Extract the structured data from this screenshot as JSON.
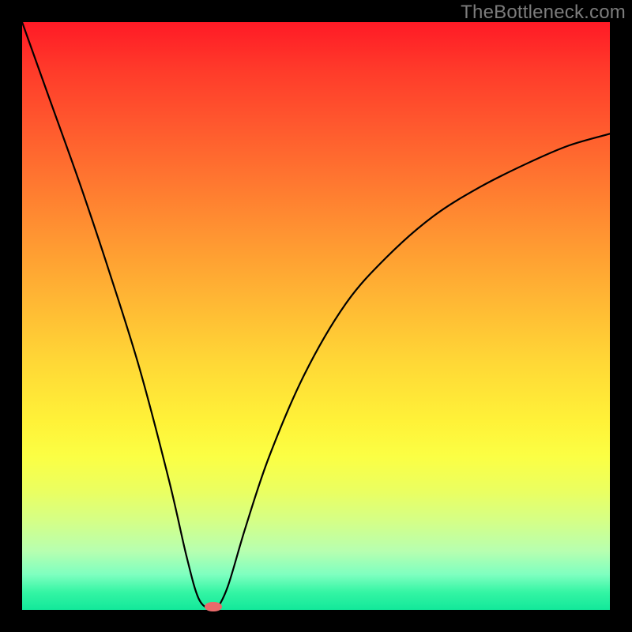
{
  "watermark": "TheBottleneck.com",
  "colors": {
    "frame_bg": "#000000",
    "curve": "#000000",
    "marker": "#e96a6a",
    "watermark": "#7c7c7c"
  },
  "chart_data": {
    "type": "line",
    "title": "",
    "xlabel": "",
    "ylabel": "",
    "xlim": [
      0,
      100
    ],
    "ylim": [
      0,
      100
    ],
    "grid": false,
    "x": [
      0,
      5,
      10,
      15,
      20,
      25,
      28,
      30,
      32,
      33,
      35,
      38,
      42,
      48,
      55,
      62,
      70,
      78,
      86,
      93,
      100
    ],
    "values": [
      100,
      86,
      72,
      57,
      41,
      22,
      9,
      2,
      0,
      0,
      4,
      14,
      26,
      40,
      52,
      60,
      67,
      72,
      76,
      79,
      81
    ],
    "marker": {
      "x": 32.5,
      "y": 0.5
    },
    "gradient_stops": [
      {
        "pos": 0.0,
        "color": "#ff1a26"
      },
      {
        "pos": 0.08,
        "color": "#ff3a2a"
      },
      {
        "pos": 0.18,
        "color": "#ff5a2e"
      },
      {
        "pos": 0.28,
        "color": "#ff7a30"
      },
      {
        "pos": 0.38,
        "color": "#ff9a32"
      },
      {
        "pos": 0.48,
        "color": "#ffb934"
      },
      {
        "pos": 0.58,
        "color": "#ffd836"
      },
      {
        "pos": 0.68,
        "color": "#fff238"
      },
      {
        "pos": 0.74,
        "color": "#fbff44"
      },
      {
        "pos": 0.8,
        "color": "#eaff62"
      },
      {
        "pos": 0.85,
        "color": "#d4ff88"
      },
      {
        "pos": 0.9,
        "color": "#b7ffb0"
      },
      {
        "pos": 0.94,
        "color": "#7effc0"
      },
      {
        "pos": 0.97,
        "color": "#34f5a4"
      },
      {
        "pos": 1.0,
        "color": "#12e89a"
      }
    ]
  }
}
